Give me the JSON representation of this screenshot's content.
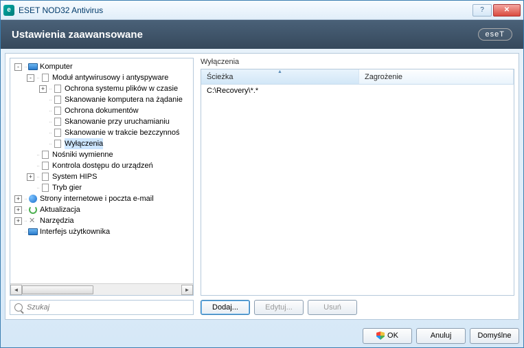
{
  "window": {
    "title": "ESET NOD32 Antivirus",
    "app_icon_letter": "e"
  },
  "header": {
    "title": "Ustawienia zaawansowane",
    "logo": "eseT"
  },
  "tree": [
    {
      "depth": 0,
      "toggle": "-",
      "icon": "monitor",
      "label": "Komputer"
    },
    {
      "depth": 1,
      "toggle": "-",
      "icon": "doc",
      "label": "Moduł antywirusowy i antyspyware"
    },
    {
      "depth": 2,
      "toggle": "+",
      "icon": "doc",
      "label": "Ochrona systemu plików w czasie"
    },
    {
      "depth": 2,
      "toggle": "",
      "icon": "doc",
      "label": "Skanowanie komputera na żądanie"
    },
    {
      "depth": 2,
      "toggle": "",
      "icon": "doc",
      "label": "Ochrona dokumentów"
    },
    {
      "depth": 2,
      "toggle": "",
      "icon": "doc",
      "label": "Skanowanie przy uruchamianiu"
    },
    {
      "depth": 2,
      "toggle": "",
      "icon": "doc",
      "label": "Skanowanie w trakcie bezczynnoś"
    },
    {
      "depth": 2,
      "toggle": "",
      "icon": "doc",
      "label": "Wyłączenia",
      "selected": true
    },
    {
      "depth": 1,
      "toggle": "",
      "icon": "doc",
      "label": "Nośniki wymienne"
    },
    {
      "depth": 1,
      "toggle": "",
      "icon": "doc",
      "label": "Kontrola dostępu do urządzeń"
    },
    {
      "depth": 1,
      "toggle": "+",
      "icon": "doc",
      "label": "System HIPS"
    },
    {
      "depth": 1,
      "toggle": "",
      "icon": "doc",
      "label": "Tryb gier"
    },
    {
      "depth": 0,
      "toggle": "+",
      "icon": "globe",
      "label": "Strony internetowe i poczta e-mail"
    },
    {
      "depth": 0,
      "toggle": "+",
      "icon": "refresh",
      "label": "Aktualizacja"
    },
    {
      "depth": 0,
      "toggle": "+",
      "icon": "tools",
      "label": "Narzędzia"
    },
    {
      "depth": 0,
      "toggle": "",
      "icon": "monitor",
      "label": "Interfejs użytkownika"
    }
  ],
  "search": {
    "placeholder": "Szukaj"
  },
  "right": {
    "section_title": "Wyłączenia",
    "columns": {
      "path": "Ścieżka",
      "threat": "Zagrożenie"
    },
    "rows": [
      {
        "path": "C:\\Recovery\\*.*",
        "threat": ""
      }
    ],
    "buttons": {
      "add": "Dodaj...",
      "edit": "Edytuj...",
      "delete": "Usuń"
    }
  },
  "footer": {
    "ok": "OK",
    "cancel": "Anuluj",
    "default": "Domyślne"
  }
}
